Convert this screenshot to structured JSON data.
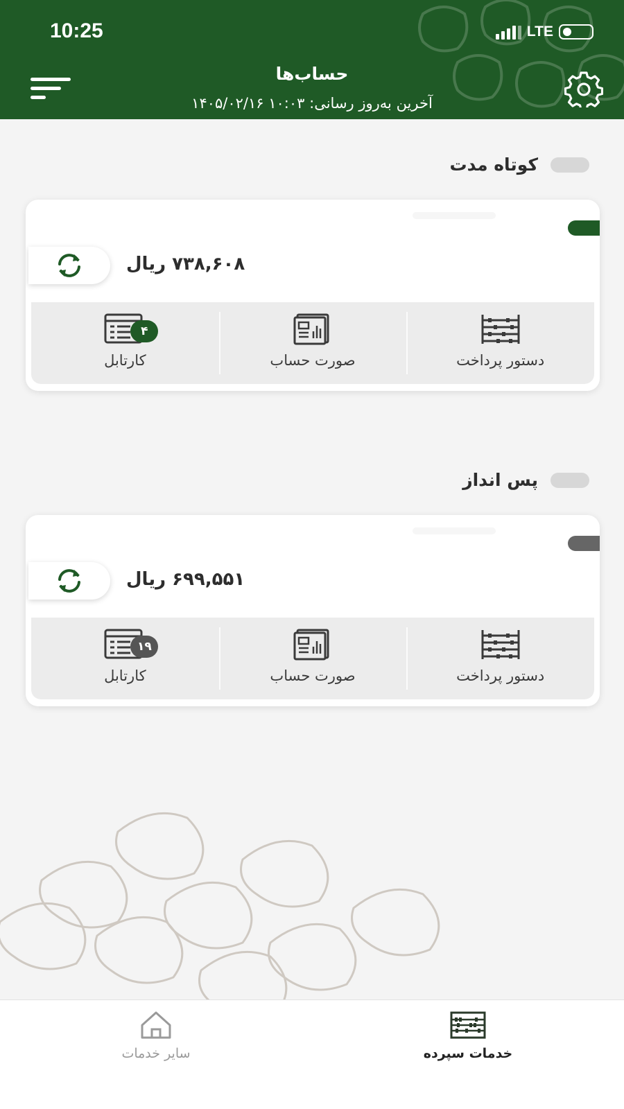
{
  "status_bar": {
    "time": "10:25",
    "network": "LTE"
  },
  "header": {
    "title": "حساب‌ها",
    "subtitle": "آخرین به‌روز رسانی:  ۱۰:۰۳ ۱۴۰۵/۰۲/۱۶",
    "icons": {
      "menu": "filter-menu-icon",
      "settings": "gear-icon"
    }
  },
  "colors": {
    "brand_green": "#1f5a26",
    "background": "#f4f4f4",
    "savings_accent": "#666666"
  },
  "accounts": [
    {
      "section_label": "کوتاه مدت",
      "balance": "۷۳۸,۶۰۸ ریال",
      "accent_color": "#1f5a26",
      "actions": [
        {
          "label": "دستور پرداخت",
          "icon": "abacus-icon"
        },
        {
          "label": "صورت حساب",
          "icon": "statement-icon"
        },
        {
          "label": "کارتابل",
          "icon": "cartable-icon",
          "badge": "۴",
          "badge_color": "#1f5a26"
        }
      ]
    },
    {
      "section_label": "پس انداز",
      "balance": "۶۹۹,۵۵۱ ریال",
      "accent_color": "#666666",
      "actions": [
        {
          "label": "دستور پرداخت",
          "icon": "abacus-icon"
        },
        {
          "label": "صورت حساب",
          "icon": "statement-icon"
        },
        {
          "label": "کارتابل",
          "icon": "cartable-icon",
          "badge": "۱۹",
          "badge_color": "#555555"
        }
      ]
    }
  ],
  "bottom_nav": [
    {
      "label": "سایر خدمات",
      "icon": "home-icon",
      "active": false
    },
    {
      "label": "خدمات سپرده",
      "icon": "abacus-icon",
      "active": true
    }
  ]
}
